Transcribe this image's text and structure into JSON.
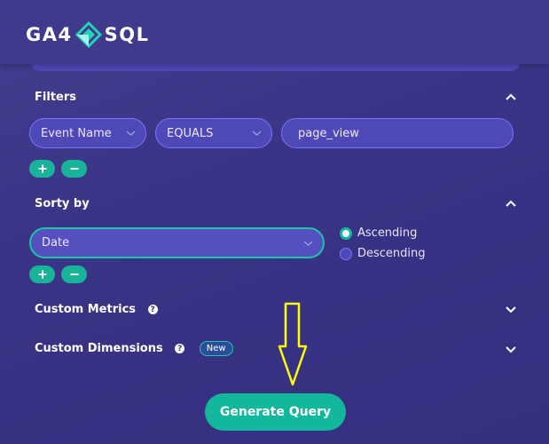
{
  "brand": {
    "left": "GA4",
    "right": "SQL"
  },
  "filters": {
    "title": "Filters",
    "field": "Event Name",
    "operator": "EQUALS",
    "value": "page_view"
  },
  "sort": {
    "title": "Sorty by",
    "field": "Date",
    "options": [
      "Ascending",
      "Descending"
    ],
    "selected": "Ascending"
  },
  "custom_metrics": {
    "title": "Custom Metrics",
    "help": "?"
  },
  "custom_dimensions": {
    "title": "Custom Dimensions",
    "help": "?",
    "badge": "New"
  },
  "generate_button": "Generate Query",
  "colors": {
    "accent": "#13b79c",
    "background": "#3a3486",
    "annotation_arrow": "#ffff00"
  },
  "icons": [
    "chevron-up-icon",
    "chevron-down-icon",
    "plus-icon",
    "minus-icon",
    "help-icon",
    "arrow-down-icon"
  ]
}
